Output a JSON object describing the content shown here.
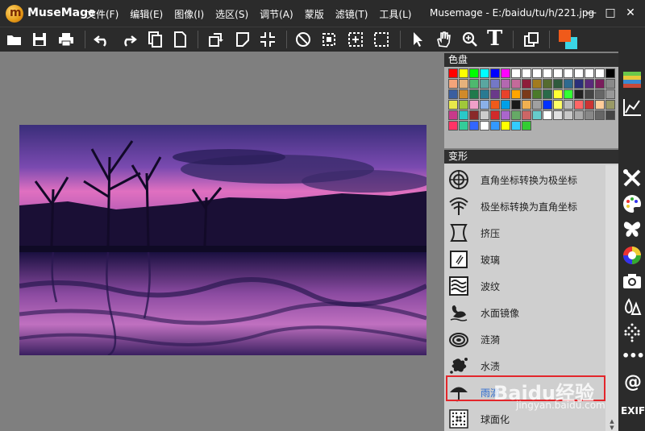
{
  "app": {
    "name": "MuseMage",
    "logo_letter": "m",
    "window_title": "Musemage - E:/baidu/tu/h/221.jpg"
  },
  "menu": [
    "文件(F)",
    "编辑(E)",
    "图像(I)",
    "选区(S)",
    "调节(A)",
    "蒙版",
    "滤镜(T)",
    "工具(L)"
  ],
  "window_controls": {
    "minimize": "—",
    "maximize": "□",
    "close": "✕"
  },
  "toolbar": {
    "icons": [
      "open-folder-icon",
      "save-icon",
      "print-icon",
      "undo-icon",
      "redo-icon",
      "copy-icon",
      "new-document-icon",
      "rotate-icon",
      "transform-icon",
      "crop-icon",
      "ellipse-select-icon",
      "rect-select-icon",
      "magic-select-icon",
      "marquee-icon",
      "pointer-icon",
      "hand-icon",
      "zoom-icon",
      "text-icon",
      "layers-icon",
      "color-swatch-icon"
    ],
    "text_tool_glyph": "T",
    "foreground_color": "#f05a1a",
    "background_color": "#3ad6e6"
  },
  "palette": {
    "title": "色盘",
    "colors": [
      "#ff0000",
      "#ffff00",
      "#00ff00",
      "#00ffff",
      "#0000ff",
      "#ff00ff",
      "#ffffff",
      "#ffffff",
      "#ffffff",
      "#ffffff",
      "#ffffff",
      "#ffffff",
      "#ffffff",
      "#ffffff",
      "#ffffff",
      "#000000",
      "#f4a47a",
      "#e6b27c",
      "#4eb86e",
      "#5aa6a0",
      "#7478c6",
      "#b368b0",
      "#c46a9a",
      "#8e1d3a",
      "#a27b1e",
      "#556b2f",
      "#2e5a3d",
      "#2f6a8f",
      "#2b2f7a",
      "#5a2a7a",
      "#7a1d5c",
      "#8a8a8a",
      "#3a5ea0",
      "#d08a2a",
      "#1f7a4c",
      "#2a7a92",
      "#6a3a8a",
      "#e8422a",
      "#ffa500",
      "#7b3a1a",
      "#4a7a2a",
      "#2a6a4a",
      "#ffff33",
      "#33ff33",
      "#222222",
      "#444444",
      "#666666",
      "#999999",
      "#e8e84a",
      "#a0c83a",
      "#f0a0c8",
      "#8ab0e8",
      "#f05a1a",
      "#00a0e8",
      "#1a1a1a",
      "#f0b050",
      "#a0a0a0",
      "#0030ff",
      "#ffff66",
      "#bbbbbb",
      "#ff6666",
      "#cc3333",
      "#ffcc99",
      "#999966",
      "#c83a8a",
      "#2ac8c8",
      "#8a2a2a",
      "#cccccc",
      "#d02a2a",
      "#aa66cc",
      "#66aa66",
      "#cc6666",
      "#66cccc",
      "#ffffff",
      "#e0e0e0",
      "#c8c8c8",
      "#aaaaaa",
      "#888888",
      "#666666",
      "#444444",
      "#ff3366",
      "#33cc99",
      "#3366ff",
      "#ffffff",
      "#3399ff",
      "#ffff00",
      "#33ccff",
      "#33cc33"
    ]
  },
  "transform": {
    "title": "变形",
    "items": [
      {
        "label": "直角坐标转换为极坐标",
        "icon": "polar-target-icon"
      },
      {
        "label": "极坐标转换为直角坐标",
        "icon": "rect-coordinate-icon"
      },
      {
        "label": "挤压",
        "icon": "squeeze-icon"
      },
      {
        "label": "玻璃",
        "icon": "glass-icon"
      },
      {
        "label": "波纹",
        "icon": "wave-icon"
      },
      {
        "label": "水面镜像",
        "icon": "swan-icon"
      },
      {
        "label": "涟漪",
        "icon": "ripple-icon"
      },
      {
        "label": "水渍",
        "icon": "splash-icon"
      },
      {
        "label": "雨滴",
        "icon": "umbrella-icon"
      },
      {
        "label": "球面化",
        "icon": "sphere-dots-icon"
      }
    ]
  },
  "right_strip": {
    "icons": [
      "swatches-icon",
      "curve-chart-icon",
      "tools-icon",
      "palette-icon",
      "butterfly-icon",
      "color-wheel-icon",
      "camera-icon",
      "drops-icon",
      "dots-grid-icon",
      "more-icon",
      "at-icon"
    ],
    "more_glyph": "•••",
    "at_glyph": "@",
    "exif_label": "EXIF"
  },
  "watermark": {
    "text": "Baidu经验",
    "sub": "jingyan.baidu.com"
  }
}
